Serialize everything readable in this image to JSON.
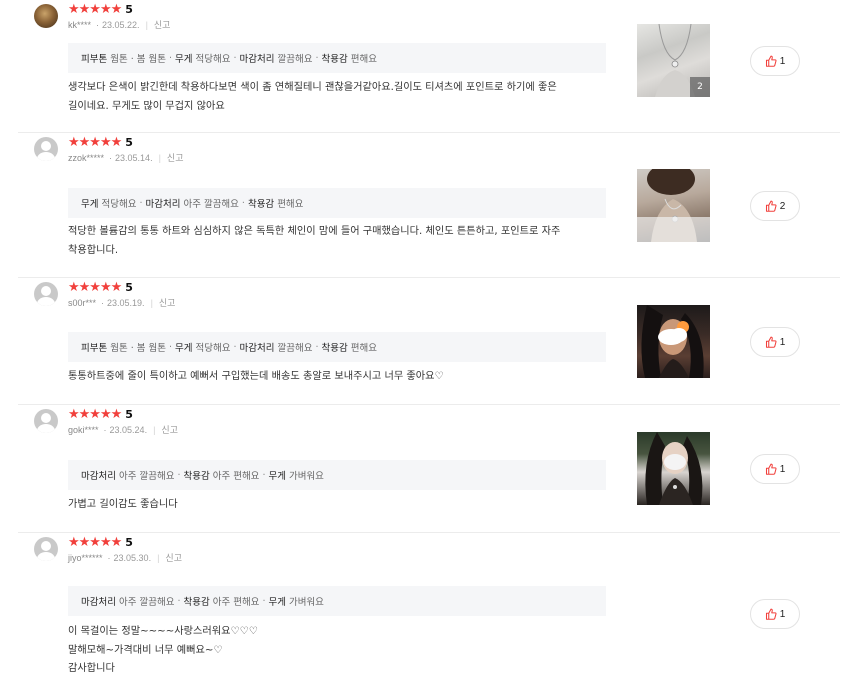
{
  "reviews": [
    {
      "avatar": "photo",
      "stars": "★★★★★",
      "score": "5",
      "user": "kk****",
      "date": "23.05.22.",
      "report": "신고",
      "tags": [
        {
          "key": "피부톤",
          "value": "웜톤 · 봄 웜톤"
        },
        {
          "key": "무게",
          "value": "적당해요"
        },
        {
          "key": "마감처리",
          "value": "깔끔해요"
        },
        {
          "key": "착용감",
          "value": "편해요"
        }
      ],
      "text": [
        "생각보다 은색이 밝긴한데 착용하다보면 색이 좀 연해질테니 괜찮을거같아요.길이도 티셔츠에 포인트로 하기에 좋은",
        "길이네요. 무게도 많이 무겁지 않아요"
      ],
      "image_count": "2",
      "likes": "1"
    },
    {
      "avatar": "default",
      "stars": "★★★★★",
      "score": "5",
      "user": "zzok*****",
      "date": "23.05.14.",
      "report": "신고",
      "tags": [
        {
          "key": "무게",
          "value": "적당해요"
        },
        {
          "key": "마감처리",
          "value": "아주 깔끔해요"
        },
        {
          "key": "착용감",
          "value": "편해요"
        }
      ],
      "text": [
        "적당한 볼륨감의 통통 하트와 심심하지 않은 독특한 체인이 맘에 들어 구매했습니다. 체인도 튼튼하고, 포인트로 자주",
        "착용합니다."
      ],
      "image_count": "",
      "likes": "2"
    },
    {
      "avatar": "default",
      "stars": "★★★★★",
      "score": "5",
      "user": "s00r***",
      "date": "23.05.19.",
      "report": "신고",
      "tags": [
        {
          "key": "피부톤",
          "value": "웜톤 · 봄 웜톤"
        },
        {
          "key": "무게",
          "value": "적당해요"
        },
        {
          "key": "마감처리",
          "value": "깔끔해요"
        },
        {
          "key": "착용감",
          "value": "편해요"
        }
      ],
      "text": [
        "통통하트중에   줄이 특이하고 예뻐서 구입했는데 배송도 총알로 보내주시고 너무 좋아요♡"
      ],
      "image_count": "",
      "likes": "1"
    },
    {
      "avatar": "default",
      "stars": "★★★★★",
      "score": "5",
      "user": "goki****",
      "date": "23.05.24.",
      "report": "신고",
      "tags": [
        {
          "key": "마감처리",
          "value": "아주 깔끔해요"
        },
        {
          "key": "착용감",
          "value": "아주 편해요"
        },
        {
          "key": "무게",
          "value": "가벼워요"
        }
      ],
      "text": [
        "가볍고 길이감도 좋습니다"
      ],
      "image_count": "",
      "likes": "1"
    },
    {
      "avatar": "default",
      "stars": "★★★★★",
      "score": "5",
      "user": "jiyo******",
      "date": "23.05.30.",
      "report": "신고",
      "tags": [
        {
          "key": "마감처리",
          "value": "아주 깔끔해요"
        },
        {
          "key": "착용감",
          "value": "아주 편해요"
        },
        {
          "key": "무게",
          "value": "가벼워요"
        }
      ],
      "text": [
        "이 목걸이는 정말~~~~사랑스러워요♡♡♡",
        "말해모해~가격대비 너무 예뻐요~♡",
        "감사합니다"
      ],
      "image_count": "",
      "likes": "1"
    }
  ]
}
